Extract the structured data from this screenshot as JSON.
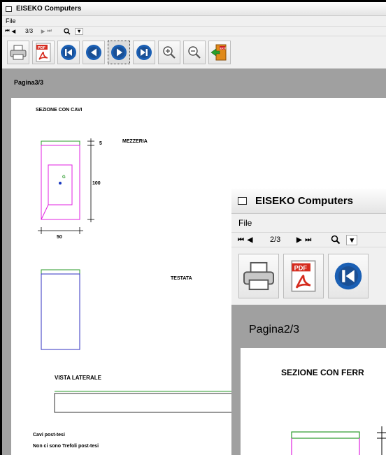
{
  "back_window": {
    "title": "EISEKO Computers",
    "menu": [
      "File"
    ],
    "nav": {
      "first": "⏮",
      "prev": "◀",
      "page": "3/3",
      "next": "▶",
      "last": "⏭",
      "zoom_icon": "search-icon",
      "dropdown": "▾"
    },
    "toolbar": [
      "printer-icon",
      "pdf-icon",
      "first-page-icon",
      "previous-page-icon",
      "next-page-icon",
      "last-page-icon",
      "zoom-in-icon",
      "zoom-out-icon",
      "exit-icon"
    ],
    "page_label": "Pagina3/3",
    "page": {
      "heading": "SEZIONE CON CAVI",
      "mezzeria_label": "MEZZERIA",
      "dim_top": "5",
      "dim_height": "100",
      "dim_width": "50",
      "centroid": "G",
      "testata_label": "TESTATA",
      "vista_label": "VISTA LATERALE",
      "note_1": "Cavi post-tesi",
      "note_2": "Non ci sono Trefoli post-tesi"
    }
  },
  "front_window": {
    "title": "EISEKO Computers",
    "menu": [
      "File"
    ],
    "nav": {
      "first": "⏮",
      "prev": "◀",
      "page": "2/3",
      "next": "▶",
      "last": "⏭",
      "zoom_icon": "search-icon",
      "dropdown": "▾"
    },
    "toolbar": [
      "printer-icon",
      "pdf-icon",
      "first-page-icon"
    ],
    "page_label": "Pagina2/3",
    "page": {
      "heading": "SEZIONE CON FERR"
    }
  },
  "colors": {
    "magenta": "#e020e0",
    "green": "#2a9a2a",
    "blue": "#3030c0",
    "circle_blue": "#1a5fb4",
    "pdf_red": "#d52b1e",
    "exit_orange": "#e08a1a"
  }
}
